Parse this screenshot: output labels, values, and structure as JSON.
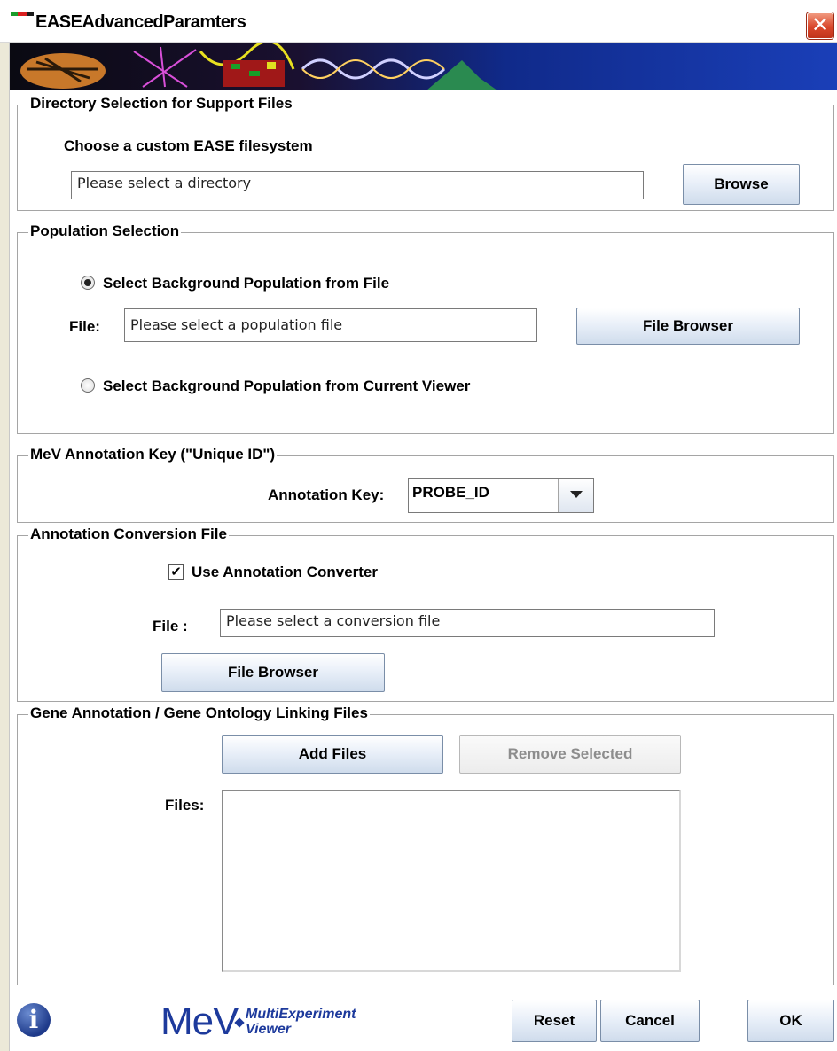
{
  "window": {
    "title": "EASEAdvancedParamters",
    "close_glyph": "✕"
  },
  "directory_panel": {
    "title": "Directory Selection for Support Files",
    "subtitle": "Choose a custom EASE filesystem",
    "path_value": "Please select a directory",
    "browse_label": "Browse"
  },
  "population_panel": {
    "title": "Population Selection",
    "option_file_label": "Select Background Population from File",
    "option_file_selected": true,
    "file_label": "File:",
    "file_value": "Please select a population file",
    "file_browser_label": "File Browser",
    "option_viewer_label": "Select Background Population from Current Viewer",
    "option_viewer_selected": false
  },
  "annotation_key_panel": {
    "title": "MeV Annotation Key  (\"Unique ID\")",
    "key_label": "Annotation Key:",
    "key_value": "PROBE_ID"
  },
  "conversion_panel": {
    "title": "Annotation Conversion File",
    "use_converter_label": "Use Annotation Converter",
    "use_converter_checked": true,
    "checkmark": "✔",
    "file_label": "File :",
    "file_value": "Please select a conversion file",
    "file_browser_label": "File Browser"
  },
  "linking_panel": {
    "title": "Gene Annotation / Gene Ontology Linking Files",
    "add_files_label": "Add Files",
    "remove_selected_label": "Remove Selected",
    "files_label": "Files:",
    "files": []
  },
  "footer": {
    "info_glyph": "i",
    "logo_text": "MeV",
    "logo_sub_line1": "MultiExperiment",
    "logo_sub_line2": "Viewer",
    "reset_label": "Reset",
    "cancel_label": "Cancel",
    "ok_label": "OK"
  }
}
